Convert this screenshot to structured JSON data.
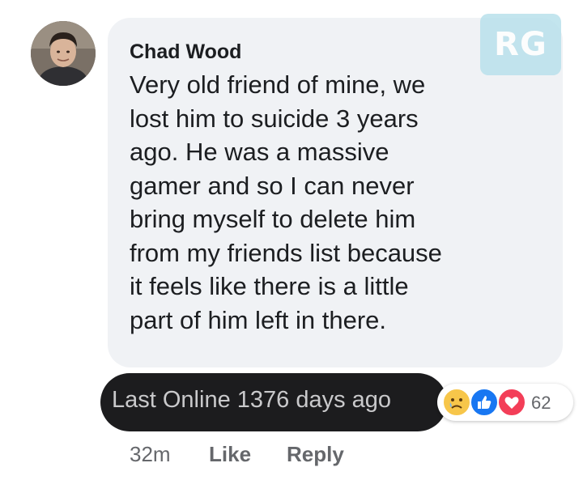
{
  "watermark": "RG",
  "comment": {
    "author": "Chad Wood",
    "text": "Very old friend of mine, we\nlost him to suicide 3 years\nago. He was a massive\ngamer and so I can never\nbring myself to delete him\nfrom my friends list because\nit feels like there is a little\npart of him left in there."
  },
  "status_pill": {
    "text": "Last Online 1376 days ago"
  },
  "reactions": {
    "icons": [
      "sad-icon",
      "like-icon",
      "love-icon"
    ],
    "count": "62",
    "colors": {
      "sad": "#f7c64a",
      "like": "#1877f2",
      "love": "#f33e58"
    }
  },
  "actions": {
    "time": "32m",
    "like": "Like",
    "reply": "Reply"
  }
}
